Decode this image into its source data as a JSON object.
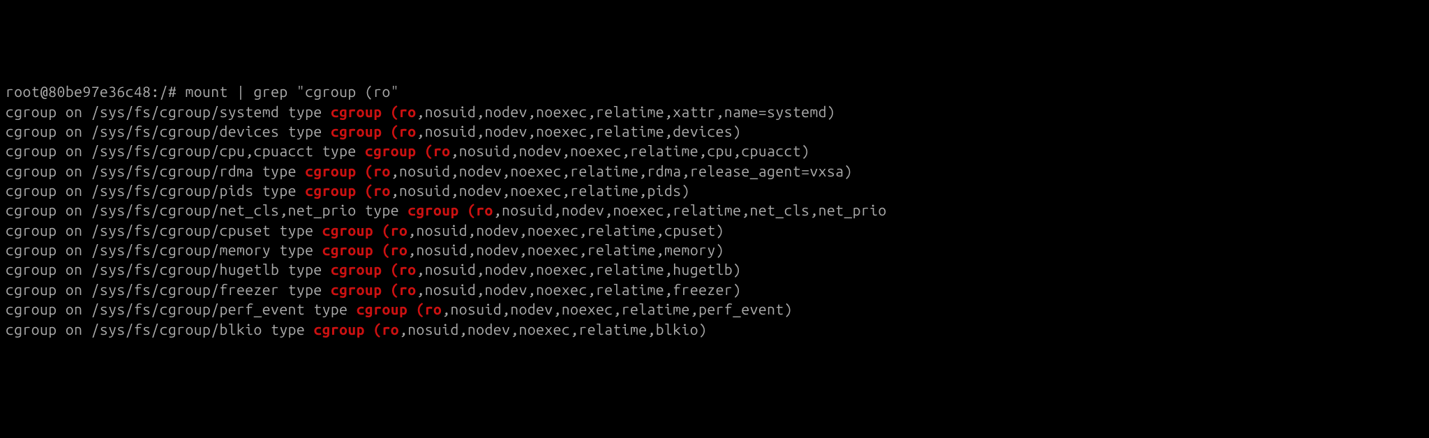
{
  "prompt": "root@80be97e36c48:/# ",
  "command": "mount | grep \"cgroup (ro\"",
  "match_text": "cgroup (ro",
  "lines": [
    {
      "pre": "cgroup on /sys/fs/cgroup/systemd type ",
      "post": ",nosuid,nodev,noexec,relatime,xattr,name=systemd)"
    },
    {
      "pre": "cgroup on /sys/fs/cgroup/devices type ",
      "post": ",nosuid,nodev,noexec,relatime,devices)"
    },
    {
      "pre": "cgroup on /sys/fs/cgroup/cpu,cpuacct type ",
      "post": ",nosuid,nodev,noexec,relatime,cpu,cpuacct)"
    },
    {
      "pre": "cgroup on /sys/fs/cgroup/rdma type ",
      "post": ",nosuid,nodev,noexec,relatime,rdma,release_agent=vxsa)"
    },
    {
      "pre": "cgroup on /sys/fs/cgroup/pids type ",
      "post": ",nosuid,nodev,noexec,relatime,pids)"
    },
    {
      "pre": "cgroup on /sys/fs/cgroup/net_cls,net_prio type ",
      "post": ",nosuid,nodev,noexec,relatime,net_cls,net_prio"
    },
    {
      "pre": "cgroup on /sys/fs/cgroup/cpuset type ",
      "post": ",nosuid,nodev,noexec,relatime,cpuset)"
    },
    {
      "pre": "cgroup on /sys/fs/cgroup/memory type ",
      "post": ",nosuid,nodev,noexec,relatime,memory)"
    },
    {
      "pre": "cgroup on /sys/fs/cgroup/hugetlb type ",
      "post": ",nosuid,nodev,noexec,relatime,hugetlb)"
    },
    {
      "pre": "cgroup on /sys/fs/cgroup/freezer type ",
      "post": ",nosuid,nodev,noexec,relatime,freezer)"
    },
    {
      "pre": "cgroup on /sys/fs/cgroup/perf_event type ",
      "post": ",nosuid,nodev,noexec,relatime,perf_event)"
    },
    {
      "pre": "cgroup on /sys/fs/cgroup/blkio type ",
      "post": ",nosuid,nodev,noexec,relatime,blkio)"
    }
  ]
}
